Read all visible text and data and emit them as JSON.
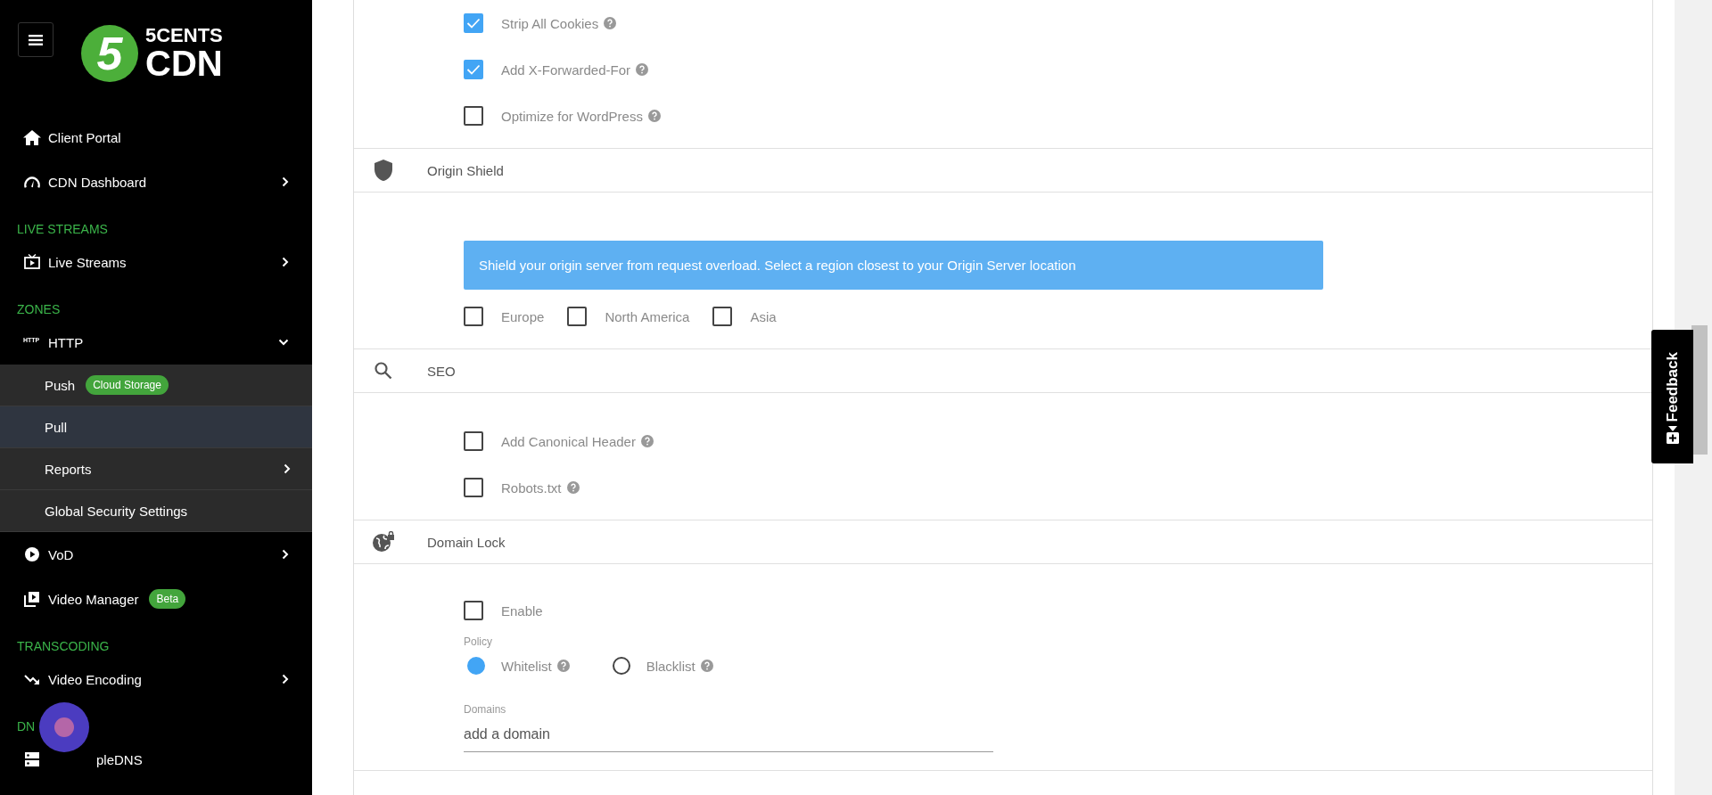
{
  "logo": {
    "digit": "5",
    "line1": "5CENTS",
    "line2": "CDN"
  },
  "sidebar": [
    {
      "kind": "item",
      "label": "Client Portal"
    },
    {
      "kind": "item",
      "label": "CDN Dashboard",
      "expanded": false
    },
    {
      "kind": "section",
      "label": "LIVE STREAMS"
    },
    {
      "kind": "item",
      "label": "Live Streams",
      "expanded": false
    },
    {
      "kind": "section",
      "label": "ZONES"
    },
    {
      "kind": "item",
      "label": "HTTP",
      "icon_text": "HTTP",
      "expanded": true
    },
    {
      "kind": "sub",
      "label": "Push",
      "badge": "Cloud Storage",
      "selected": false
    },
    {
      "kind": "sub",
      "label": "Pull",
      "selected": true
    },
    {
      "kind": "sub",
      "label": "Reports",
      "expanded": false,
      "selected": false
    },
    {
      "kind": "sub",
      "label": "Global Security Settings",
      "selected": false
    },
    {
      "kind": "item",
      "label": "VoD",
      "expanded": false
    },
    {
      "kind": "item",
      "label": "Video Manager",
      "badge": "Beta"
    },
    {
      "kind": "section",
      "label": "TRANSCODING"
    },
    {
      "kind": "item",
      "label": "Video Encoding",
      "expanded": false
    },
    {
      "kind": "section",
      "label": "DN"
    },
    {
      "kind": "item",
      "label": "pleDNS"
    }
  ],
  "sections": [
    {
      "options": [
        {
          "label": "Strip All Cookies",
          "checked": true,
          "help": true
        },
        {
          "label": "Add X-Forwarded-For",
          "checked": true,
          "help": true
        },
        {
          "label": "Optimize for WordPress",
          "checked": false,
          "help": true
        }
      ]
    },
    {
      "title": "Origin Shield",
      "alert": "Shield your origin server from request overload. Select a region closest to your Origin Server location",
      "options": [
        {
          "label": "Europe",
          "checked": false,
          "help": false
        },
        {
          "label": "North America",
          "checked": false,
          "help": false
        },
        {
          "label": "Asia",
          "checked": false,
          "help": false
        }
      ]
    },
    {
      "title": "SEO",
      "options": [
        {
          "label": "Add Canonical Header",
          "checked": false,
          "help": true
        },
        {
          "label": "Robots.txt",
          "checked": false,
          "help": true
        }
      ]
    },
    {
      "title": "Domain Lock",
      "options": [
        {
          "label": "Enable",
          "checked": false,
          "help": false
        }
      ],
      "policy": {
        "label": "Policy",
        "options": [
          {
            "label": "Whitelist",
            "selected": true,
            "help": true
          },
          {
            "label": "Blacklist",
            "selected": false,
            "help": true
          }
        ]
      },
      "domains": {
        "label": "Domains",
        "placeholder": "add a domain"
      }
    }
  ],
  "feedback": {
    "label": "Feedback"
  }
}
